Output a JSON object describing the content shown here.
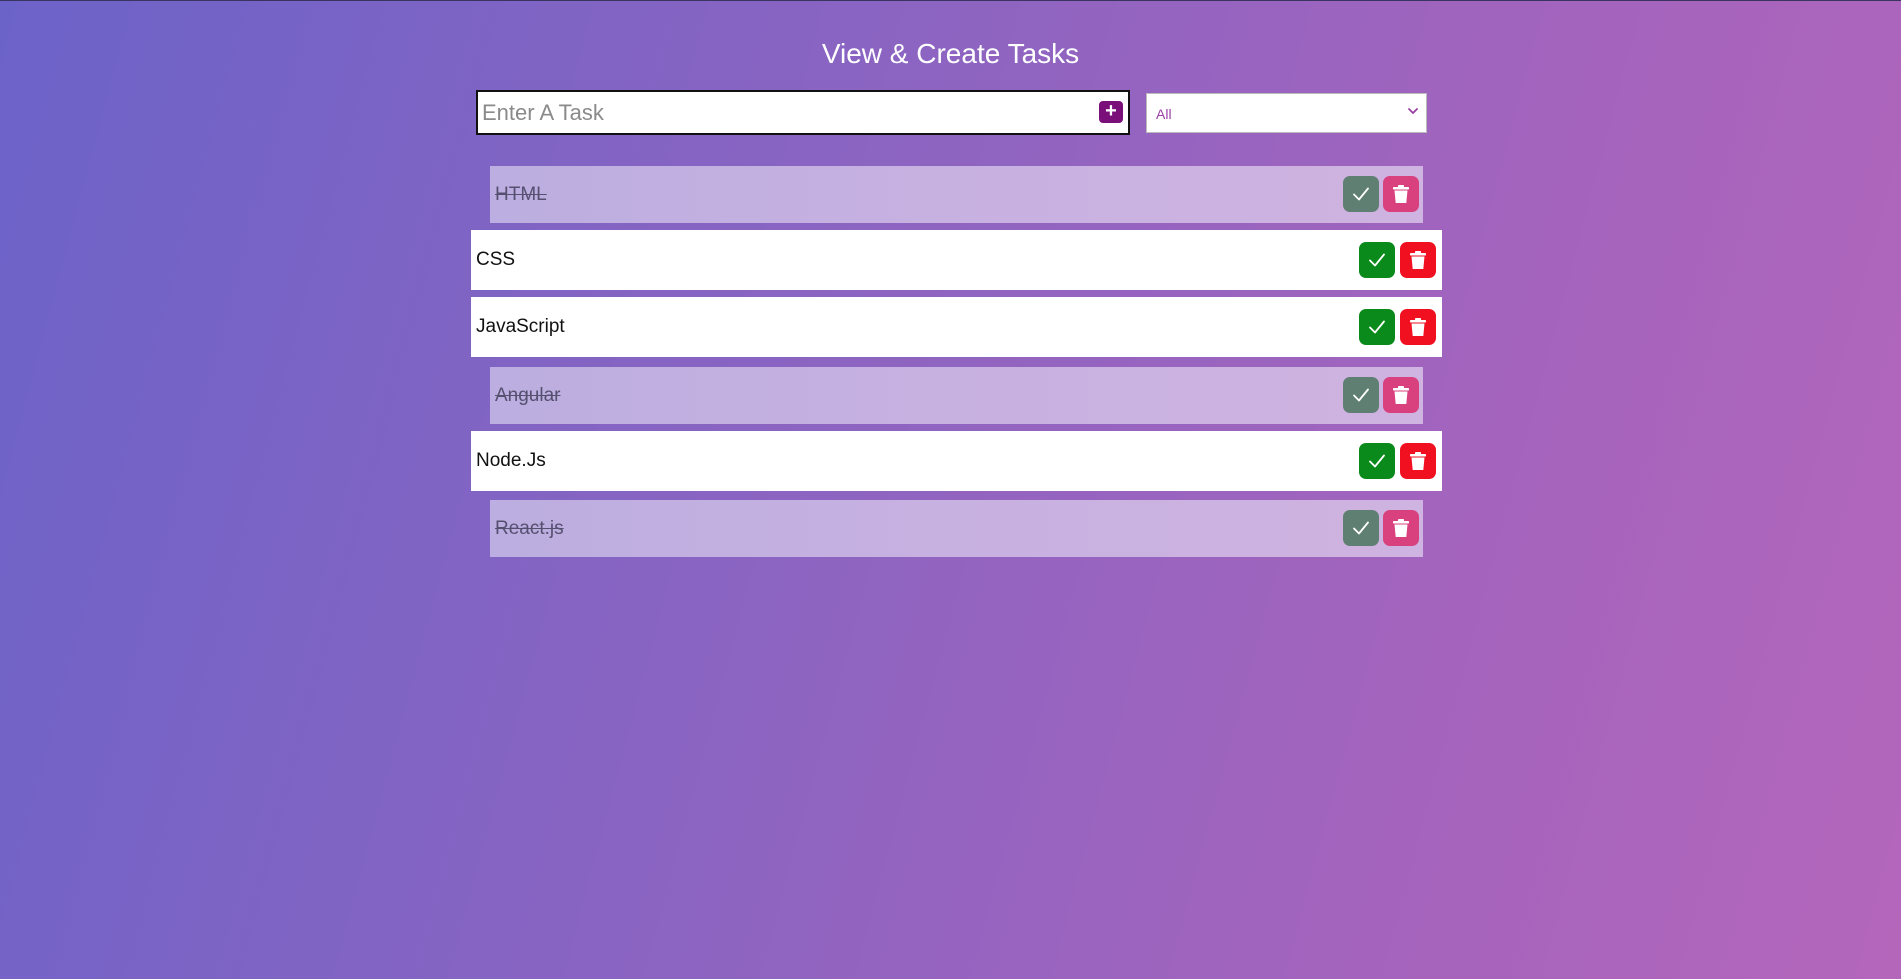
{
  "header": {
    "title": "View & Create Tasks"
  },
  "new_task": {
    "placeholder": "Enter A Task",
    "value": "",
    "add_label": "+"
  },
  "filter": {
    "selected": "All"
  },
  "tasks": [
    {
      "text": "HTML",
      "completed": true
    },
    {
      "text": "CSS",
      "completed": false
    },
    {
      "text": "JavaScript",
      "completed": false
    },
    {
      "text": "Angular",
      "completed": true
    },
    {
      "text": "Node.Js",
      "completed": false
    },
    {
      "text": "React.js",
      "completed": true
    }
  ],
  "colors": {
    "add_button": "#7a0f7a",
    "check_active": "#0a8a1a",
    "delete_active": "#f01020",
    "check_done": "#5f7f73",
    "delete_done": "#d8417e"
  },
  "icons": {
    "add": "plus-icon",
    "check": "check-icon",
    "delete": "trash-icon",
    "filter": "chevron-down-icon"
  }
}
